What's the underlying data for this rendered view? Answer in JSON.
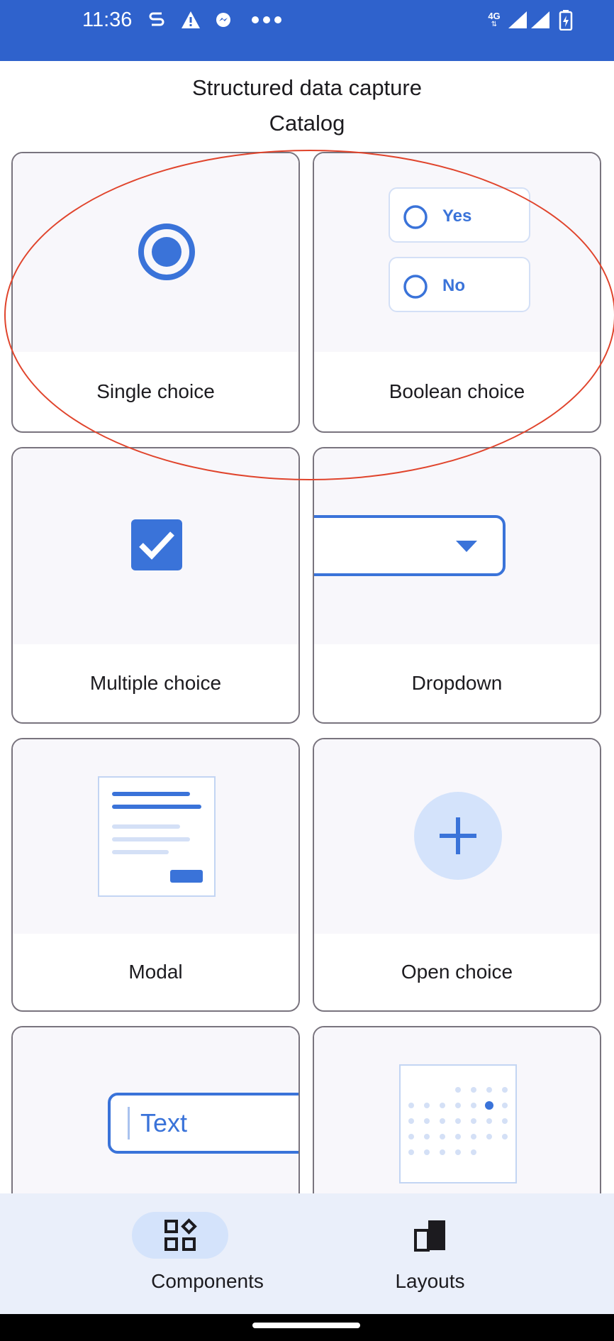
{
  "status_bar": {
    "time": "11:36",
    "network": "4G",
    "icons": [
      "sync-s-icon",
      "alert-icon",
      "messenger-icon",
      "more-dots-icon",
      "signal-icon",
      "signal-icon",
      "battery-icon"
    ]
  },
  "header": {
    "title": "Structured data capture",
    "subtitle": "Catalog"
  },
  "components": [
    {
      "label": "Single choice",
      "icon": "radio-button-icon"
    },
    {
      "label": "Boolean choice",
      "icon": "boolean-choice-icon",
      "options": [
        "Yes",
        "No"
      ]
    },
    {
      "label": "Multiple choice",
      "icon": "checkbox-icon"
    },
    {
      "label": "Dropdown",
      "icon": "dropdown-icon"
    },
    {
      "label": "Modal",
      "icon": "modal-icon"
    },
    {
      "label": "Open choice",
      "icon": "add-icon"
    },
    {
      "label": "",
      "icon": "text-field-icon",
      "preview_text": "Text"
    },
    {
      "label": "",
      "icon": "slider-grid-icon"
    }
  ],
  "bottom_nav": {
    "items": [
      {
        "label": "Components",
        "icon": "components-icon",
        "selected": true
      },
      {
        "label": "Layouts",
        "icon": "layouts-icon",
        "selected": false
      }
    ]
  },
  "colors": {
    "status_bar": "#2f62cc",
    "accent": "#3a73d9",
    "nav_background": "#eaeffa",
    "nav_selected_pill": "#d4e3fb",
    "annotation": "#e0442c"
  }
}
